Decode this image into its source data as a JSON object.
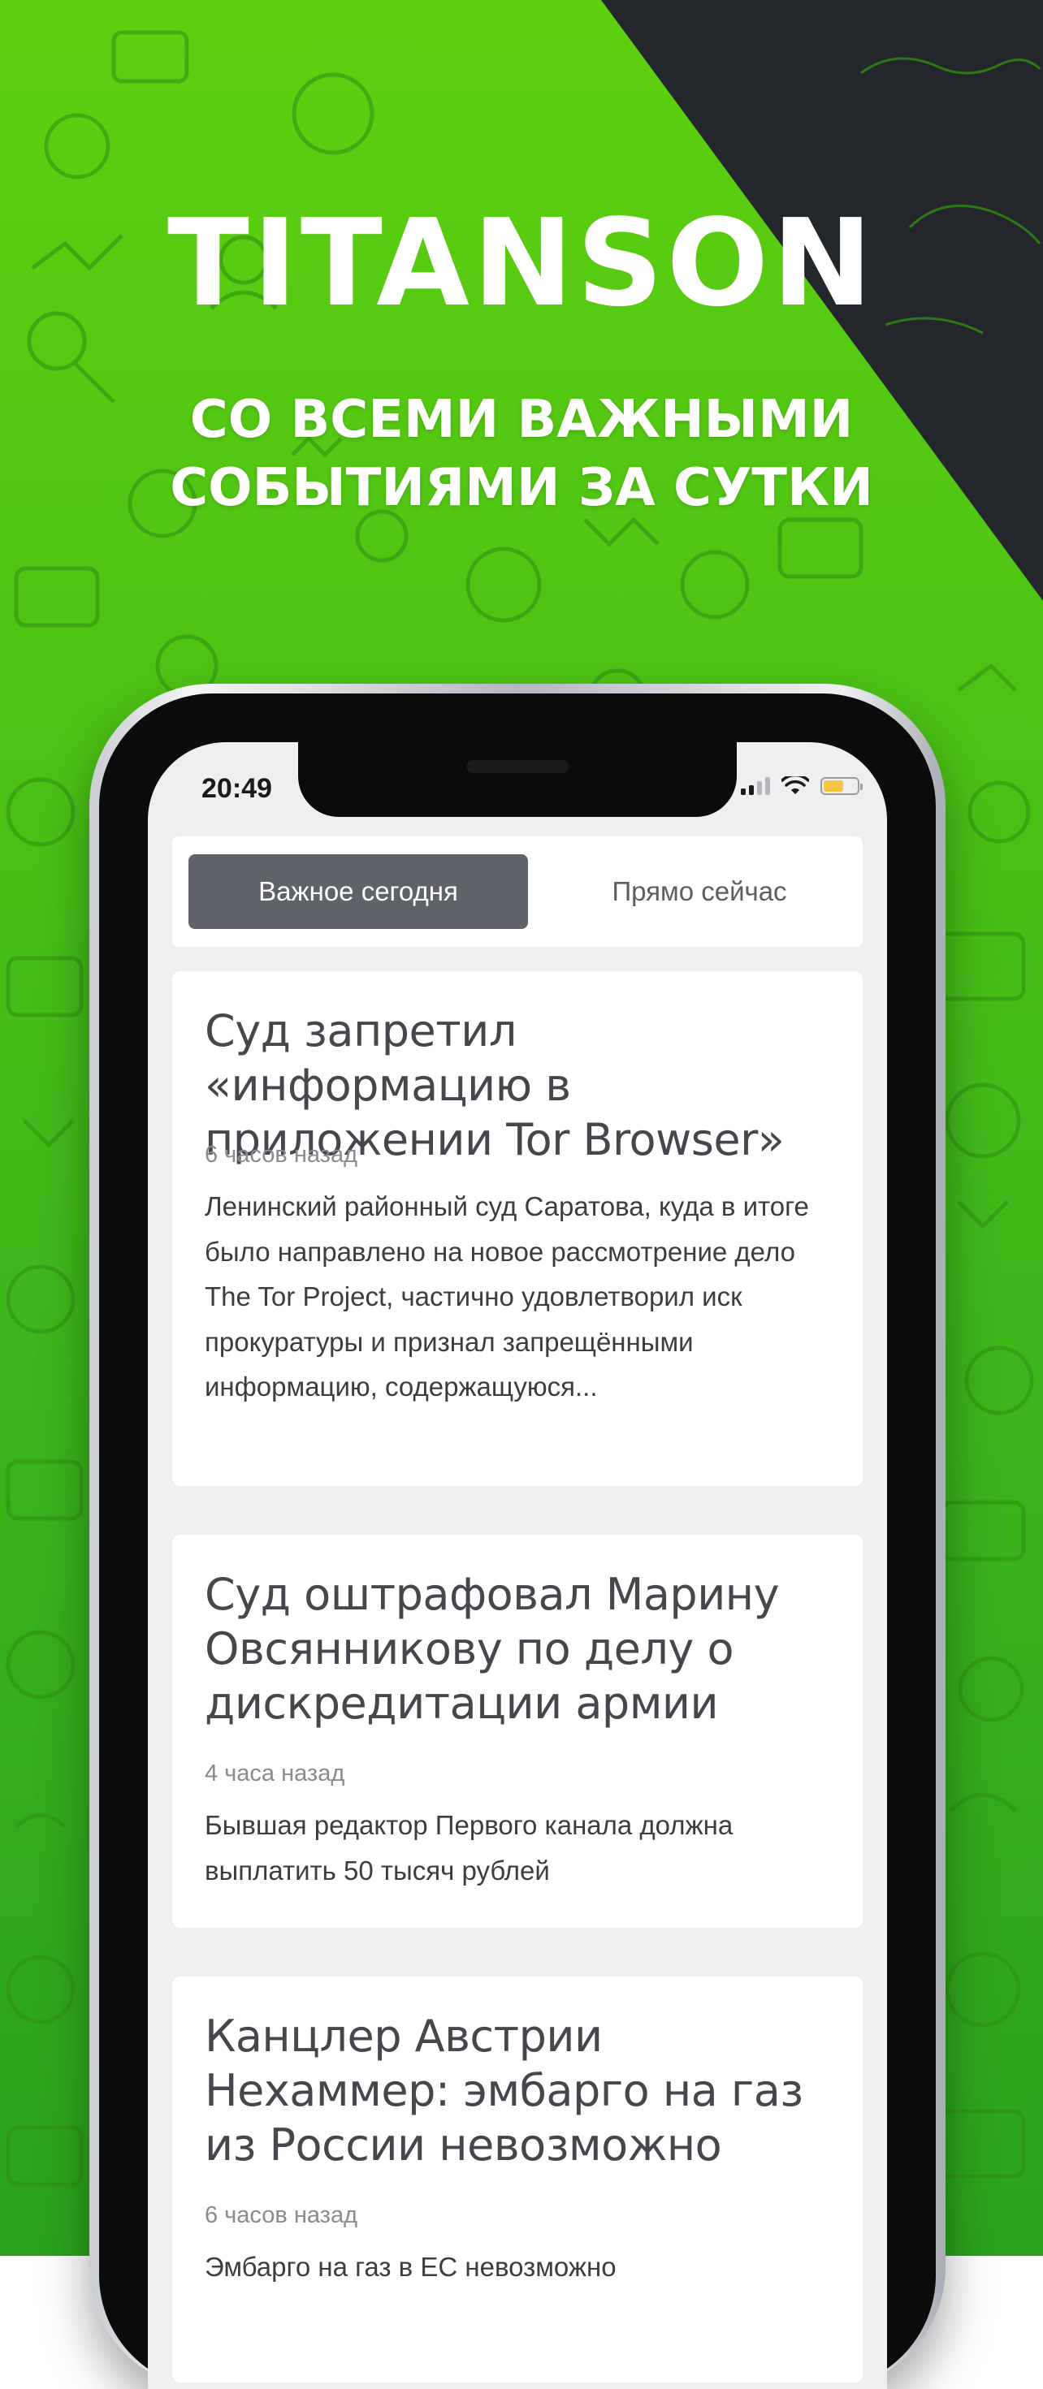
{
  "promo": {
    "title": "TITANSON",
    "subtitle_line1": "СО ВСЕМИ ВАЖНЫМИ",
    "subtitle_line2": "СОБЫТИЯМИ ЗА СУТКИ"
  },
  "status_bar": {
    "time": "20:49",
    "battery_level": 0.6
  },
  "tabs": [
    {
      "label": "Важное сегодня",
      "active": true
    },
    {
      "label": "Прямо сейчас",
      "active": false
    }
  ],
  "news": [
    {
      "title": "Суд запретил «информацию в приложении Tor Browser»",
      "time": "6 часов назад",
      "text": "Ленинский районный суд Саратова, куда в итоге было направлено на новое рассмотрение дело The Tor Project, частично удовлетворил иск прокуратуры и признал запрещёнными информацию, содержащуюся..."
    },
    {
      "title": "Суд оштрафовал Марину Овсянникову по делу о дискредитации армии",
      "time": "4 часа назад",
      "text": "Бывшая редактор Первого канала должна выплатить 50 тысяч рублей"
    },
    {
      "title": "Канцлер Австрии Нехаммер: эмбарго на газ из России невозможно",
      "time": "6 часов назад",
      "text": "Эмбарго на газ в ЕС невозможно"
    }
  ],
  "colors": {
    "green": "#4cc414",
    "dark": "#23262b",
    "active_tab": "#5f6268",
    "battery": "#f5c542"
  }
}
